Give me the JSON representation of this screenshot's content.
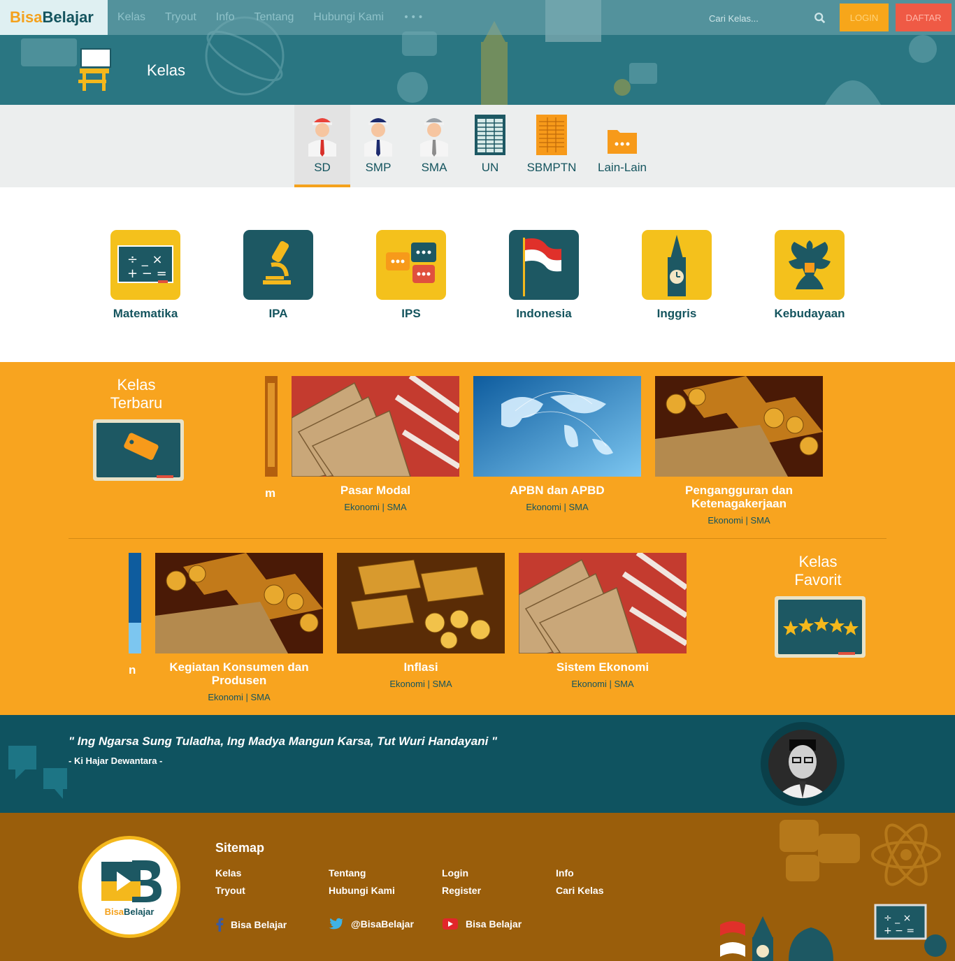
{
  "brand": {
    "part1": "Bisa",
    "part2": "Belajar"
  },
  "nav": {
    "items": [
      "Kelas",
      "Tryout",
      "Info",
      "Tentang",
      "Hubungi Kami"
    ],
    "more": "•••"
  },
  "search": {
    "placeholder": "Cari Kelas..."
  },
  "auth": {
    "login": "LOGIN",
    "register": "DAFTAR"
  },
  "hero": {
    "title": "Kelas"
  },
  "levels": [
    "SD",
    "SMP",
    "SMA",
    "UN",
    "SBMPTN",
    "Lain-Lain"
  ],
  "active_level": "SD",
  "subjects": [
    "Matematika",
    "IPA",
    "IPS",
    "Indonesia",
    "Inggris",
    "Kebudayaan"
  ],
  "latest": {
    "title": "Kelas Terbaru",
    "partial_title_tail": "m",
    "cards": [
      {
        "title": "Pasar Modal",
        "meta": "Ekonomi | SMA"
      },
      {
        "title": "APBN dan APBD",
        "meta": "Ekonomi | SMA"
      },
      {
        "title": "Pengangguran dan Ketenagakerjaan",
        "meta": "Ekonomi | SMA"
      }
    ]
  },
  "favorite": {
    "title": "Kelas Favorit",
    "partial_title_tail": "n",
    "cards": [
      {
        "title": "Kegiatan Konsumen dan Produsen",
        "meta": "Ekonomi | SMA"
      },
      {
        "title": "Inflasi",
        "meta": "Ekonomi | SMA"
      },
      {
        "title": "Sistem Ekonomi",
        "meta": "Ekonomi | SMA"
      }
    ]
  },
  "quote": {
    "text": "\" Ing Ngarsa Sung Tuladha, Ing Madya Mangun Karsa, Tut Wuri Handayani \"",
    "author": "- Ki Hajar Dewantara -"
  },
  "footer": {
    "logo": {
      "part1": "Bisa",
      "part2": "Belajar"
    },
    "sitemap_title": "Sitemap",
    "links": [
      "Kelas",
      "Tryout",
      "Tentang",
      "Hubungi Kami",
      "Login",
      "Register",
      "Info",
      "Cari Kelas"
    ],
    "social": [
      {
        "icon": "facebook-icon",
        "label": "Bisa Belajar"
      },
      {
        "icon": "twitter-icon",
        "label": "@BisaBelajar"
      },
      {
        "icon": "youtube-icon",
        "label": "Bisa Belajar"
      }
    ]
  },
  "colors": {
    "teal": "#14545e",
    "orange": "#f8a41f",
    "brown": "#9a5e0b",
    "red": "#ef5a45",
    "yellow": "#f4b81c"
  }
}
